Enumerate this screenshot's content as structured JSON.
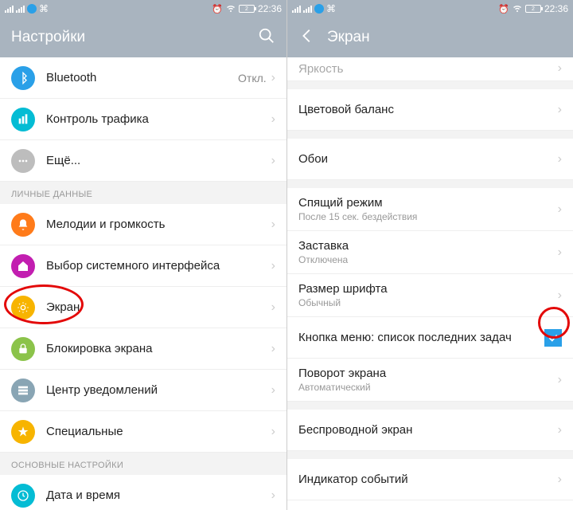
{
  "status": {
    "battery": "2",
    "time": "22:36"
  },
  "left": {
    "title": "Настройки",
    "rows": [
      {
        "icon": "bluetooth-icon",
        "color": "c-blue",
        "label": "Bluetooth",
        "value": "Откл."
      },
      {
        "icon": "traffic-icon",
        "color": "c-teal",
        "label": "Контроль трафика"
      },
      {
        "icon": "more-icon",
        "color": "c-grey",
        "label": "Ещё..."
      }
    ],
    "section1": "ЛИЧНЫЕ ДАННЫЕ",
    "rows2": [
      {
        "icon": "bell-icon",
        "color": "c-orange",
        "label": "Мелодии и громкость"
      },
      {
        "icon": "home-icon",
        "color": "c-magenta",
        "label": "Выбор системного интерфейса"
      },
      {
        "icon": "display-icon",
        "color": "c-amber",
        "label": "Экран"
      },
      {
        "icon": "lock-icon",
        "color": "c-green",
        "label": "Блокировка экрана"
      },
      {
        "icon": "notif-icon",
        "color": "c-bluegrey",
        "label": "Центр уведомлений"
      },
      {
        "icon": "star-icon",
        "color": "c-amber",
        "label": "Специальные"
      }
    ],
    "section2": "ОСНОВНЫЕ НАСТРОЙКИ",
    "rows3": [
      {
        "icon": "clock-icon",
        "color": "c-teal",
        "label": "Дата и время"
      }
    ]
  },
  "right": {
    "title": "Экран",
    "partial_top": "Яркость",
    "rows": [
      {
        "label": "Цветовой баланс"
      },
      {
        "label": "Обои"
      },
      {
        "label": "Спящий режим",
        "sub": "После 15 сек. бездействия"
      },
      {
        "label": "Заставка",
        "sub": "Отключена"
      },
      {
        "label": "Размер шрифта",
        "sub": "Обычный"
      },
      {
        "label": "Кнопка меню: список последних задач",
        "checkbox": true
      },
      {
        "label": "Поворот экрана",
        "sub": "Автоматический"
      },
      {
        "label": "Беспроводной экран"
      },
      {
        "label": "Индикатор событий"
      }
    ]
  }
}
